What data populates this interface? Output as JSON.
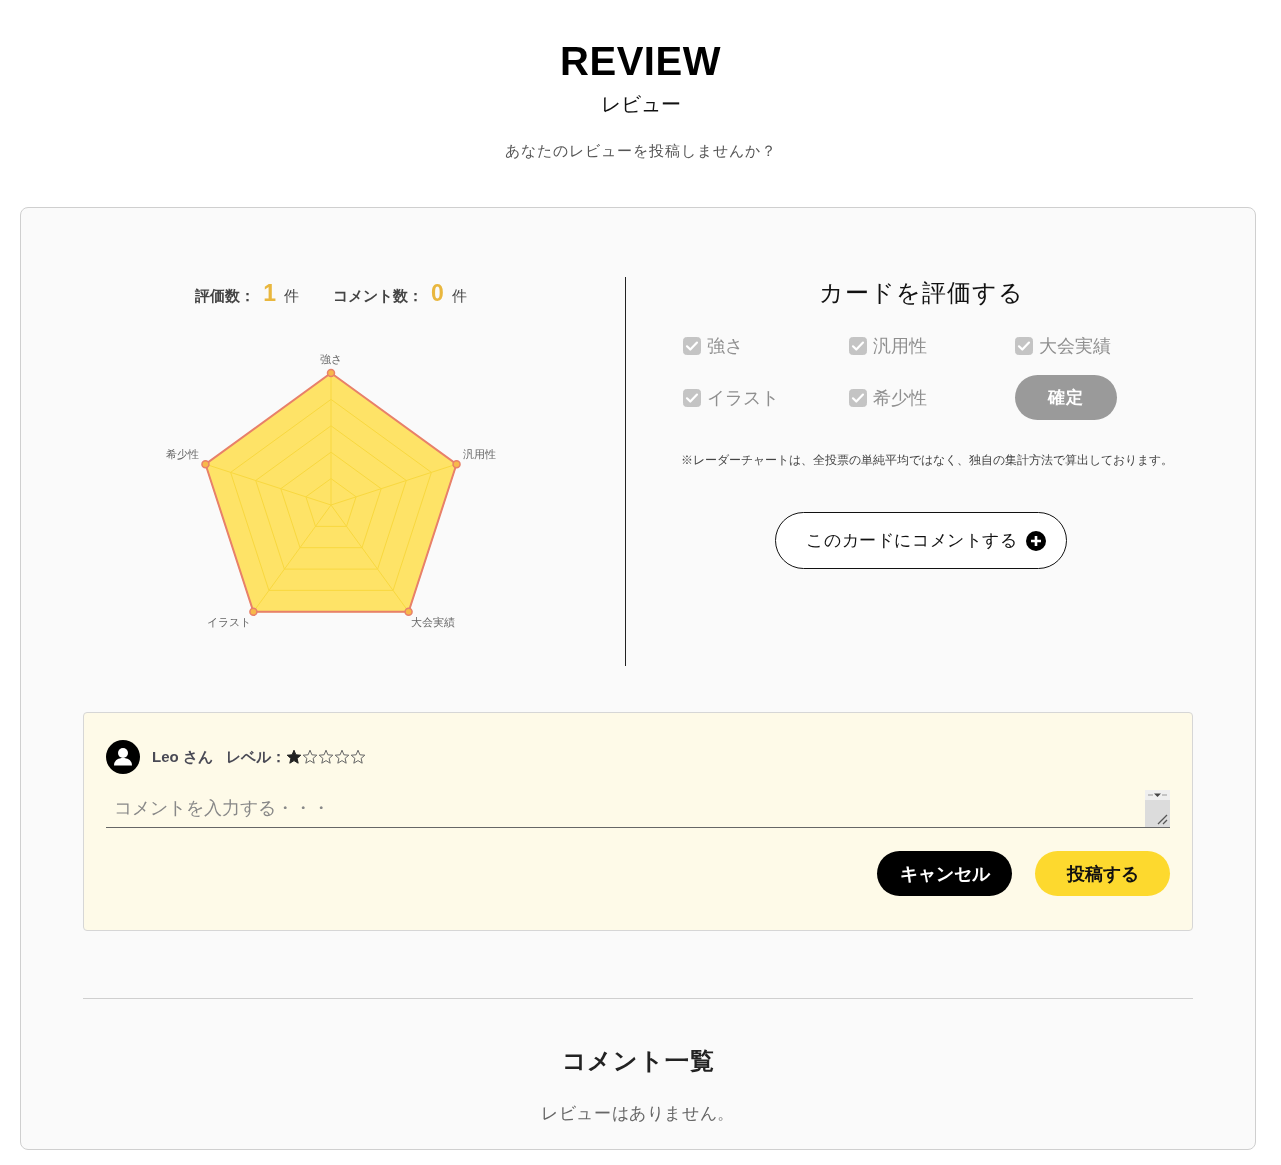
{
  "header": {
    "title": "REVIEW",
    "subtitle": "レビュー",
    "prompt": "あなたのレビューを投稿しませんか？"
  },
  "stats": [
    {
      "label": "評価数：",
      "value": "1",
      "unit": "件"
    },
    {
      "label": "コメント数：",
      "value": "0",
      "unit": "件"
    }
  ],
  "radar": {
    "axes": [
      "強さ",
      "汎用性",
      "大会実績",
      "イラスト",
      "希少性"
    ]
  },
  "rating": {
    "title": "カードを評価する",
    "criteria": [
      {
        "label": "強さ",
        "checked": true,
        "disabled": true
      },
      {
        "label": "汎用性",
        "checked": true,
        "disabled": true
      },
      {
        "label": "大会実績",
        "checked": true,
        "disabled": true
      },
      {
        "label": "イラスト",
        "checked": true,
        "disabled": true
      },
      {
        "label": "希少性",
        "checked": true,
        "disabled": true
      }
    ],
    "confirm_button": {
      "label": "確定",
      "disabled": true
    },
    "note": "※レーダーチャートは、全投票の単純平均ではなく、独自の集計方法で算出しております。",
    "comment_button": "このカードにコメントする"
  },
  "comment_form": {
    "user": "Leo さん",
    "level_label": "レベル：",
    "stars": 1,
    "placeholder": "コメントを入力する・・・",
    "buttons": [
      {
        "label": "キャンセル",
        "kind": "cancel"
      },
      {
        "label": "投稿する",
        "kind": "submit"
      }
    ]
  },
  "comments": {
    "title": "コメント一覧",
    "empty_text": "レビューはありません。"
  }
}
